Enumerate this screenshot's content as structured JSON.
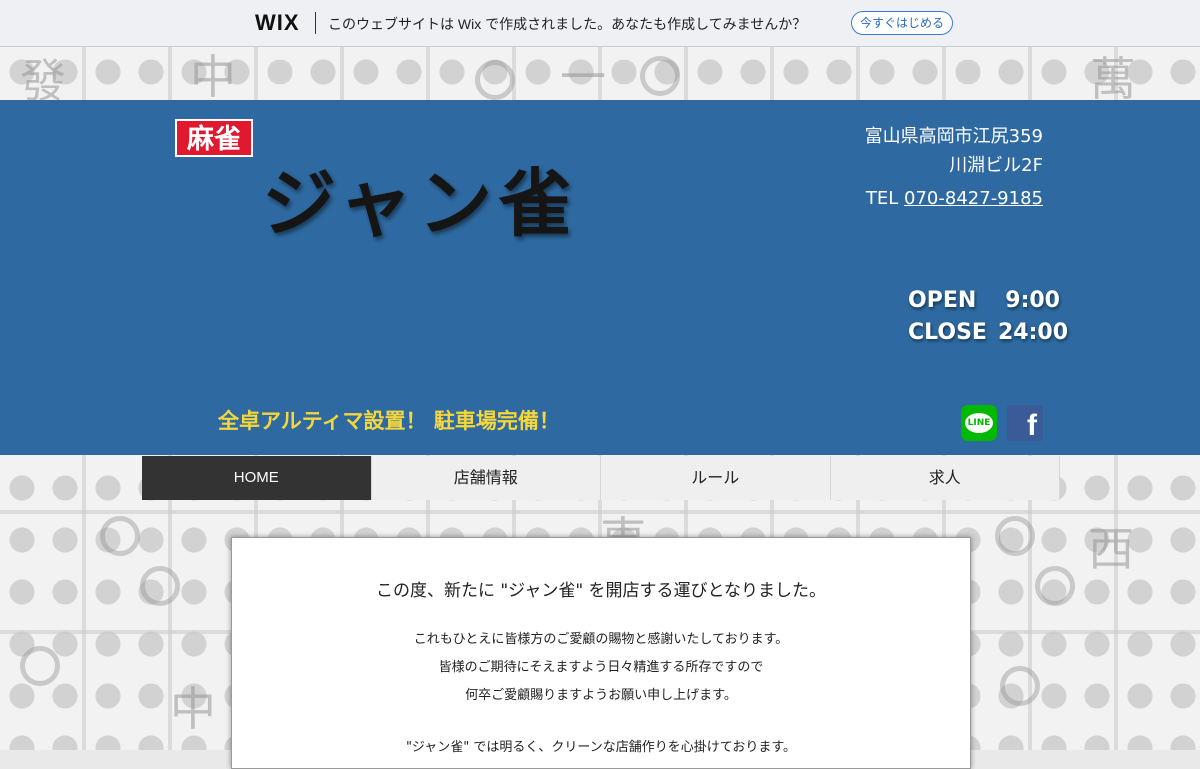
{
  "wix_banner": {
    "logo": "WIX",
    "message": "このウェブサイトは Wix で作成されました。あなたも作成してみませんか？",
    "cta": "今すぐはじめる"
  },
  "header": {
    "badge": "麻雀",
    "logo": "ジャン雀",
    "address_line1": "富山県高岡市江尻359",
    "address_line2": "川淵ビル2F",
    "tel_label": "TEL",
    "tel_number": "070-8427-9185",
    "open_label": "OPEN",
    "open_time": "9:00",
    "close_label": "CLOSE",
    "close_time": "24:00",
    "slogan": "全卓アルティマ設置！ 駐車場完備！",
    "line_icon_text": "LINE",
    "facebook_icon_text": "f"
  },
  "nav": {
    "items": [
      {
        "label": "HOME"
      },
      {
        "label": "店舗情報"
      },
      {
        "label": "ルール"
      },
      {
        "label": "求人"
      }
    ]
  },
  "content": {
    "title": "この度、新たに \"ジャン雀\" を開店する運びとなりました。",
    "line1": "これもひとえに皆様方のご愛顧の賜物と感謝いたしております。",
    "line2": "皆様のご期待にそえますよう日々精進する所存ですので",
    "line3": "何卒ご愛顧賜りますようお願い申し上げます。",
    "line4": "\"ジャン雀\" では明るく、クリーンな店舗作りを心掛けております。"
  },
  "background_glyphs": [
    "發",
    "中",
    "西",
    "東",
    "一",
    "萬"
  ]
}
